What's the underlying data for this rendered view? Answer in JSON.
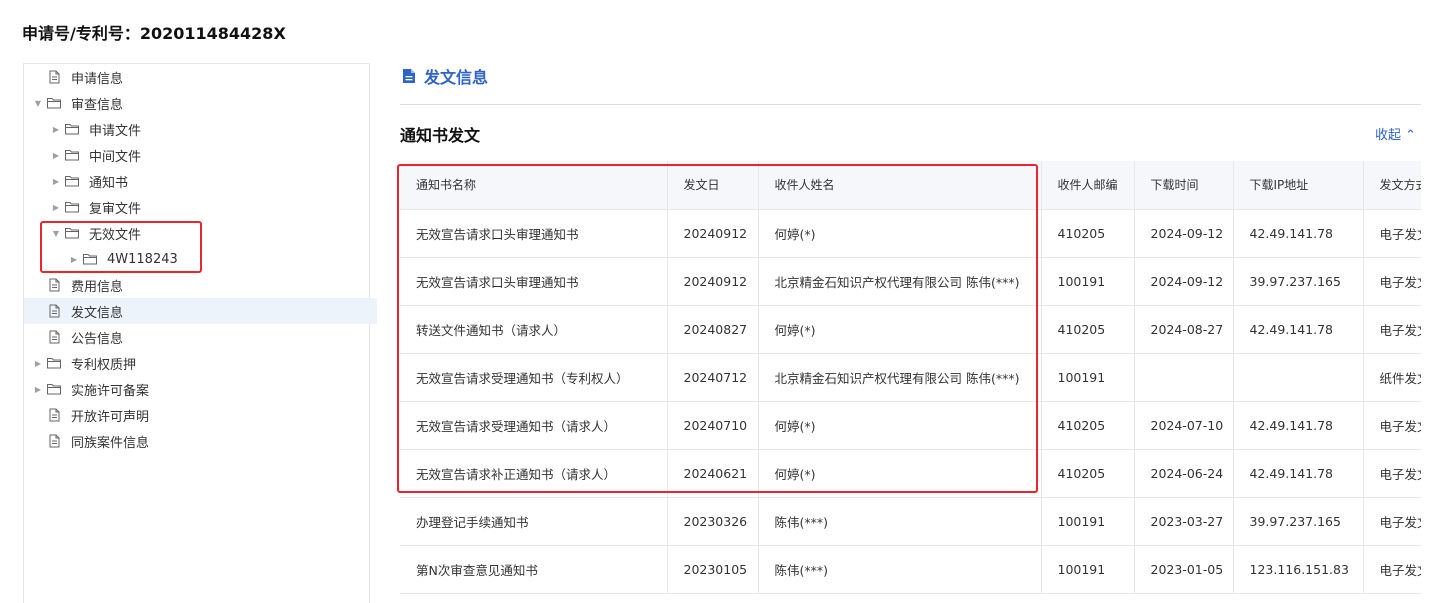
{
  "page": {
    "title": "申请号/专利号：202011484428X"
  },
  "tree": [
    {
      "label": "申请信息",
      "level": 0,
      "type": "doc",
      "expander": "none",
      "active": false
    },
    {
      "label": "审查信息",
      "level": 0,
      "type": "folder",
      "expander": "open",
      "active": false
    },
    {
      "label": "申请文件",
      "level": 1,
      "type": "folder",
      "expander": "closed",
      "active": false
    },
    {
      "label": "中间文件",
      "level": 1,
      "type": "folder",
      "expander": "closed",
      "active": false
    },
    {
      "label": "通知书",
      "level": 1,
      "type": "folder",
      "expander": "closed",
      "active": false
    },
    {
      "label": "复审文件",
      "level": 1,
      "type": "folder",
      "expander": "closed",
      "active": false
    },
    {
      "label": "无效文件",
      "level": 1,
      "type": "folder",
      "expander": "open",
      "active": false
    },
    {
      "label": "4W118243",
      "level": 2,
      "type": "folder",
      "expander": "closed",
      "active": false
    },
    {
      "label": "费用信息",
      "level": 0,
      "type": "doc",
      "expander": "none",
      "active": false
    },
    {
      "label": "发文信息",
      "level": 0,
      "type": "doc",
      "expander": "none",
      "active": true
    },
    {
      "label": "公告信息",
      "level": 0,
      "type": "doc",
      "expander": "none",
      "active": false
    },
    {
      "label": "专利权质押",
      "level": 0,
      "type": "folder",
      "expander": "closed",
      "active": false
    },
    {
      "label": "实施许可备案",
      "level": 0,
      "type": "folder",
      "expander": "closed",
      "active": false
    },
    {
      "label": "开放许可声明",
      "level": 0,
      "type": "doc",
      "expander": "none",
      "active": false
    },
    {
      "label": "同族案件信息",
      "level": 0,
      "type": "doc",
      "expander": "none",
      "active": false
    }
  ],
  "main": {
    "section_title": "发文信息",
    "subsection_title": "通知书发文",
    "collapse_label": "收起 ⌃",
    "table": {
      "columns": [
        "通知书名称",
        "发文日",
        "收件人姓名",
        "收件人邮编",
        "下载时间",
        "下载IP地址",
        "发文方式"
      ],
      "rows": [
        [
          "无效宣告请求口头审理通知书",
          "20240912",
          "何婷(*)",
          "410205",
          "2024-09-12",
          "42.49.141.78",
          "电子发文"
        ],
        [
          "无效宣告请求口头审理通知书",
          "20240912",
          "北京精金石知识产权代理有限公司 陈伟(***)",
          "100191",
          "2024-09-12",
          "39.97.237.165",
          "电子发文"
        ],
        [
          "转送文件通知书（请求人）",
          "20240827",
          "何婷(*)",
          "410205",
          "2024-08-27",
          "42.49.141.78",
          "电子发文"
        ],
        [
          "无效宣告请求受理通知书（专利权人）",
          "20240712",
          "北京精金石知识产权代理有限公司 陈伟(***)",
          "100191",
          "",
          "",
          "纸件发文"
        ],
        [
          "无效宣告请求受理通知书（请求人）",
          "20240710",
          "何婷(*)",
          "410205",
          "2024-07-10",
          "42.49.141.78",
          "电子发文"
        ],
        [
          "无效宣告请求补正通知书（请求人）",
          "20240621",
          "何婷(*)",
          "410205",
          "2024-06-24",
          "42.49.141.78",
          "电子发文"
        ],
        [
          "办理登记手续通知书",
          "20230326",
          "陈伟(***)",
          "100191",
          "2023-03-27",
          "39.97.237.165",
          "电子发文"
        ],
        [
          "第N次审查意见通知书",
          "20230105",
          "陈伟(***)",
          "100191",
          "2023-01-05",
          "123.116.151.83",
          "电子发文"
        ]
      ]
    }
  },
  "icons": {
    "doc": "document-icon",
    "folder": "folder-icon",
    "header": "file-text-icon"
  },
  "colors": {
    "accent": "#2f63c9",
    "highlight": "#e8262f",
    "active_bg": "#edf3fb",
    "header_bg": "#f5f7fa"
  }
}
